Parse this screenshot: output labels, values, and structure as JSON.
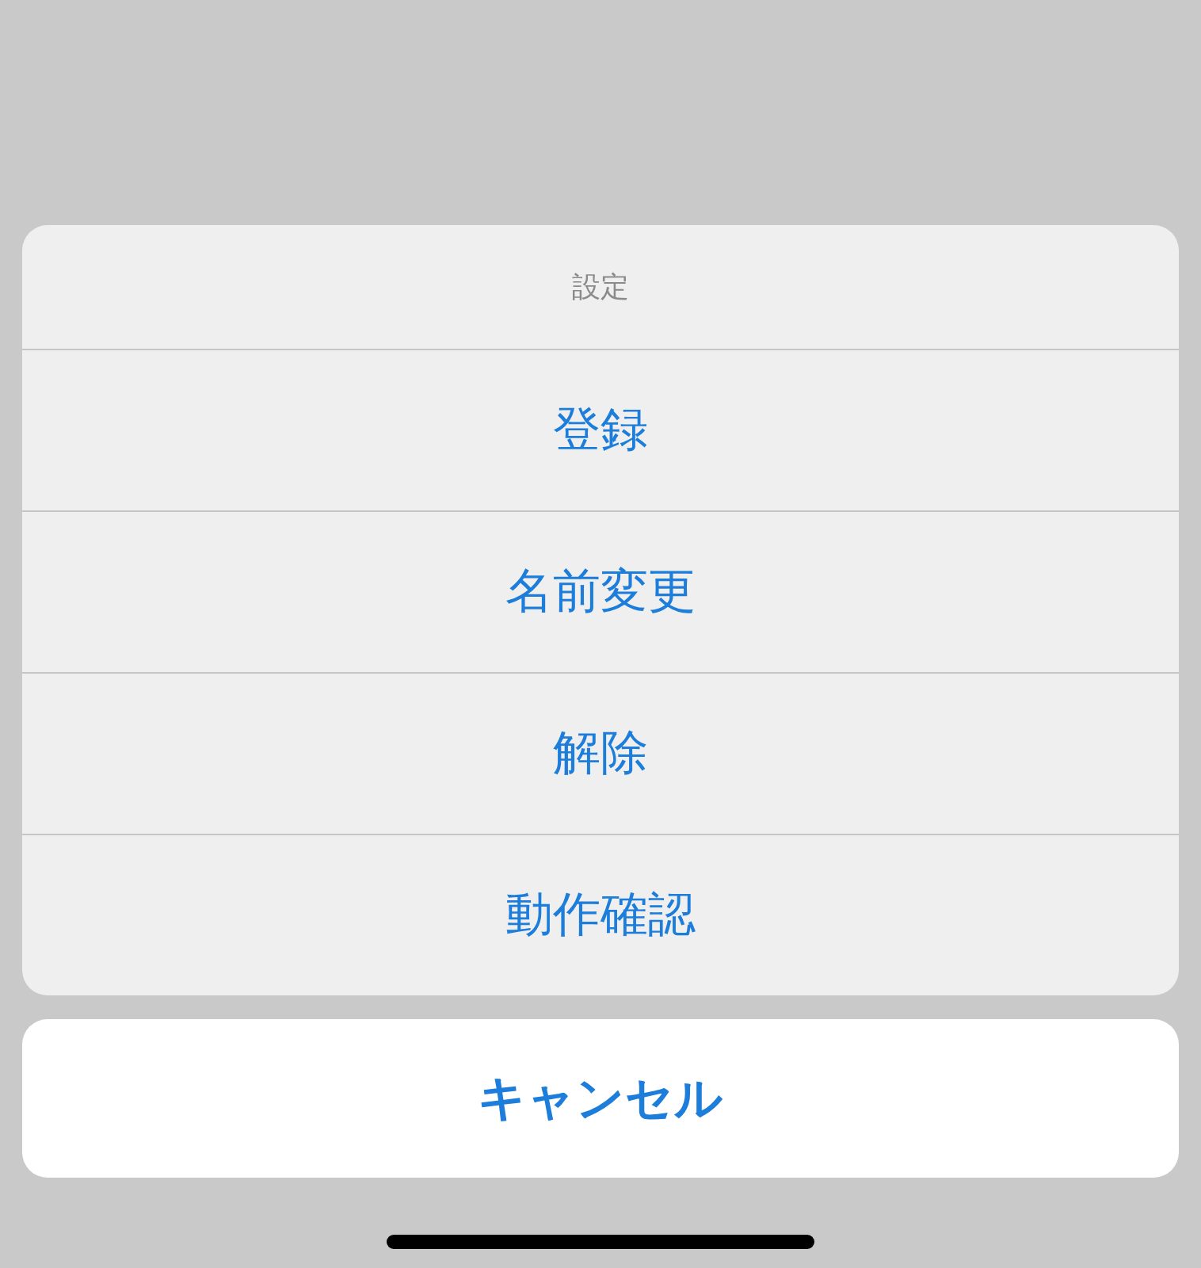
{
  "action_sheet": {
    "title": "設定",
    "actions": [
      {
        "label": "登録"
      },
      {
        "label": "名前変更"
      },
      {
        "label": "解除"
      },
      {
        "label": "動作確認"
      }
    ]
  },
  "cancel_button": {
    "label": "キャンセル"
  }
}
